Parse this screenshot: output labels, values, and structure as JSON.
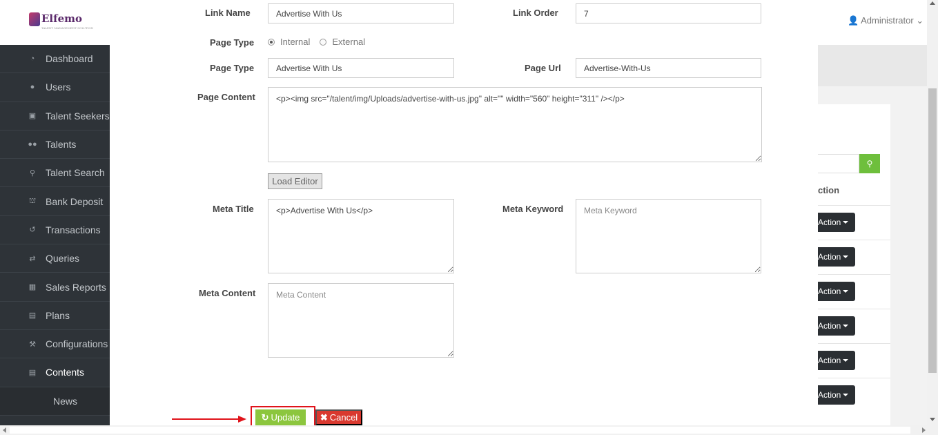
{
  "app": {
    "logo_text": "Elfemo",
    "logo_tagline": "TALENT MANAGEMENT SOLUTION",
    "user_menu": "Administrator"
  },
  "sidebar": {
    "items": [
      {
        "label": "Dashboard",
        "icon": "dashboard-icon"
      },
      {
        "label": "Users",
        "icon": "user-icon"
      },
      {
        "label": "Talent Seekers",
        "icon": "lock-icon"
      },
      {
        "label": "Talents",
        "icon": "users-icon"
      },
      {
        "label": "Talent Search",
        "icon": "search-icon"
      },
      {
        "label": "Bank Deposit",
        "icon": "bank-icon"
      },
      {
        "label": "Transactions",
        "icon": "history-icon"
      },
      {
        "label": "Queries",
        "icon": "retweet-icon"
      },
      {
        "label": "Sales Reports",
        "icon": "table-icon"
      },
      {
        "label": "Plans",
        "icon": "cart-icon"
      },
      {
        "label": "Configurations",
        "icon": "wrench-icon"
      },
      {
        "label": "Contents",
        "icon": "newspaper-icon"
      }
    ],
    "sub_item": "News"
  },
  "background_table": {
    "column_header": "ction",
    "action_label": "Action",
    "action_rows": 6
  },
  "form": {
    "link_name_label": "Link Name",
    "link_name_value": "Advertise With Us",
    "link_order_label": "Link Order",
    "link_order_value": "7",
    "page_type_radio_label": "Page Type",
    "radio_internal": "Internal",
    "radio_external": "External",
    "radio_selected": "Internal",
    "page_type_label": "Page Type",
    "page_type_value": "Advertise With Us",
    "page_url_label": "Page Url",
    "page_url_value": "Advertise-With-Us",
    "page_content_label": "Page Content",
    "page_content_value": "<p><img src=\"/talent/img/Uploads/advertise-with-us.jpg\" alt=\"\" width=\"560\" height=\"311\" /></p>",
    "load_editor_label": "Load Editor",
    "meta_title_label": "Meta Title",
    "meta_title_value": "<p>Advertise With Us</p>",
    "meta_keyword_label": "Meta Keyword",
    "meta_keyword_placeholder": "Meta Keyword",
    "meta_content_label": "Meta Content",
    "meta_content_placeholder": "Meta Content",
    "update_label": "Update",
    "cancel_label": "Cancel"
  },
  "colors": {
    "sidebar_bg": "#2e3338",
    "update_btn": "#8cc63e",
    "cancel_btn": "#d9392f",
    "search_btn": "#6ebf3c",
    "annotation_red": "#e0141b"
  }
}
